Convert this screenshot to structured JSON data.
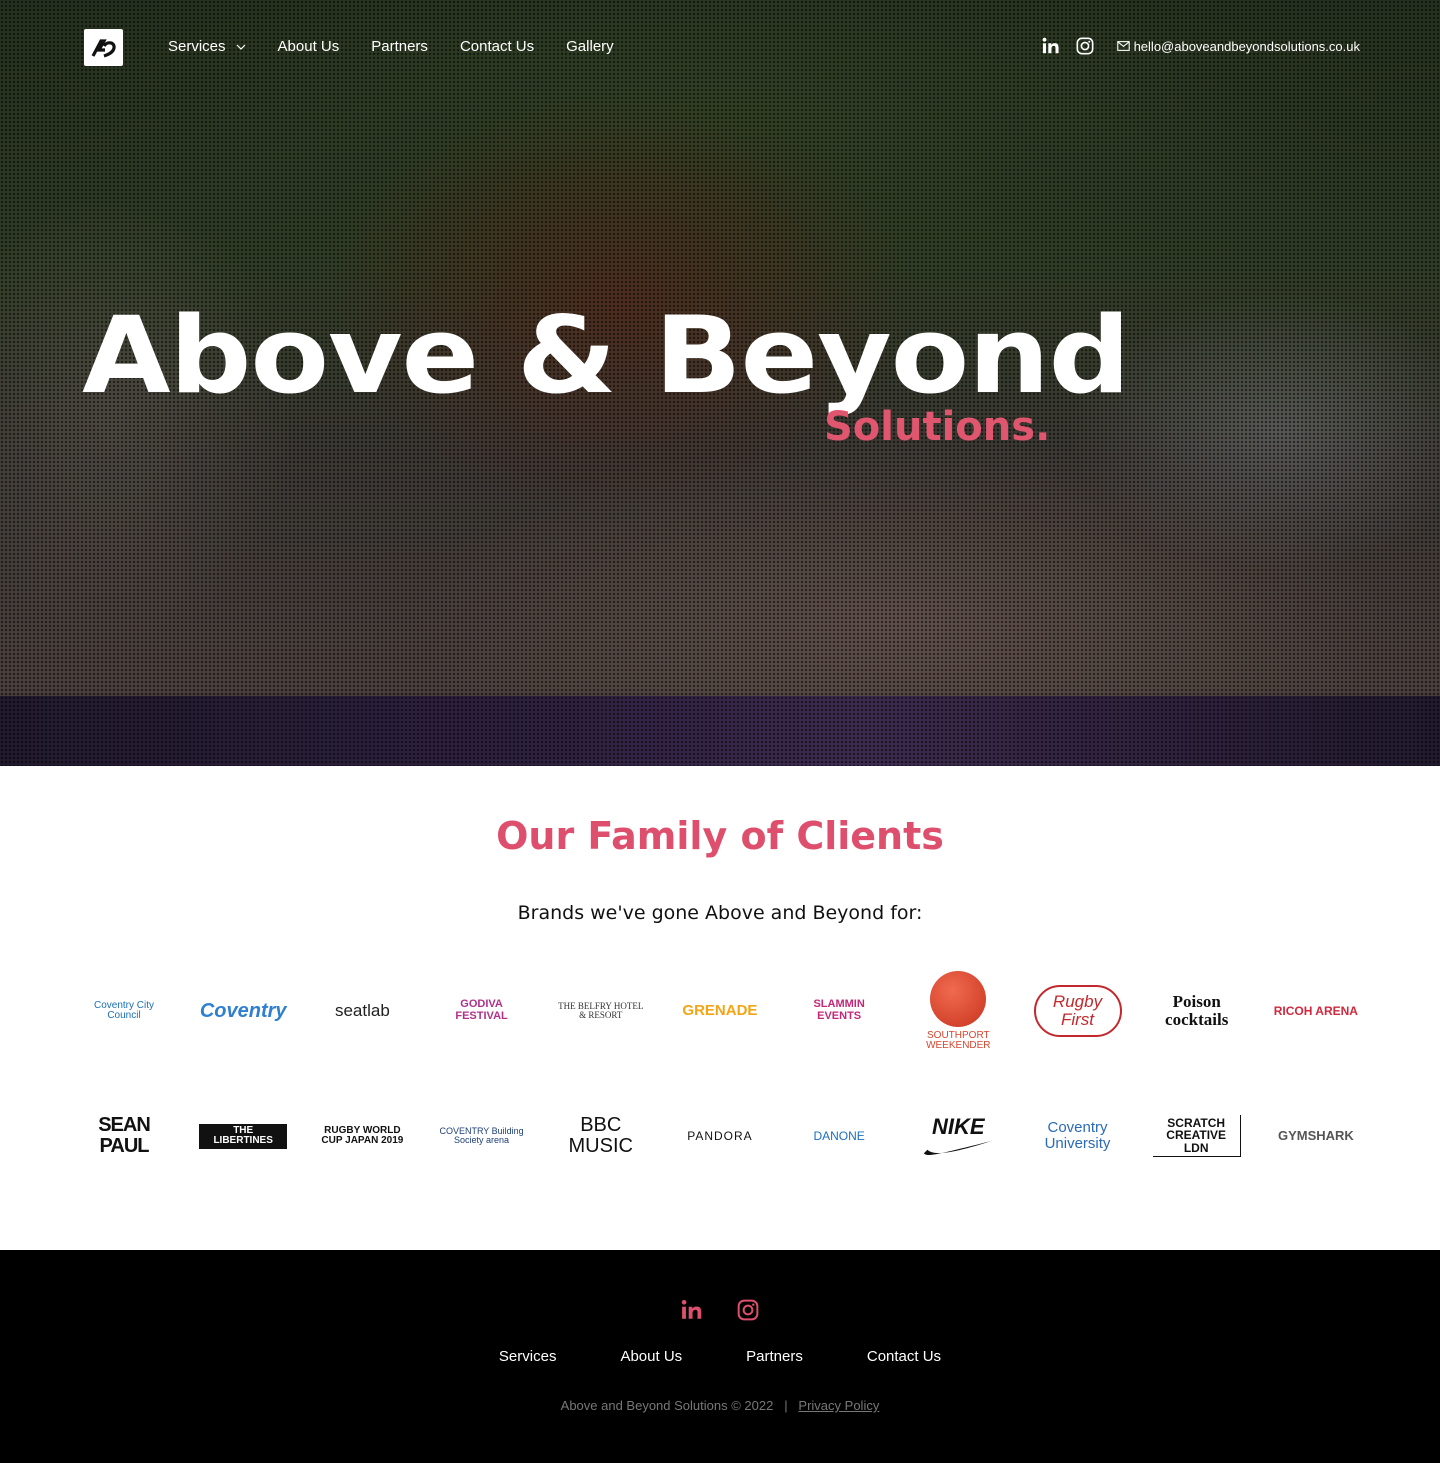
{
  "nav": {
    "items": [
      {
        "label": "Services",
        "has_dropdown": true
      },
      {
        "label": "About Us"
      },
      {
        "label": "Partners"
      },
      {
        "label": "Contact Us"
      },
      {
        "label": "Gallery"
      }
    ],
    "social_icons": [
      "linkedin-icon",
      "instagram-icon"
    ],
    "email": "hello@aboveandbeyondsolutions.co.uk"
  },
  "hero": {
    "title": "Above & Beyond",
    "subtitle": "Solutions."
  },
  "clients": {
    "title": "Our Family of Clients",
    "subtitle": "Brands we've gone Above and Beyond for:",
    "row1": [
      {
        "name": "Coventry City Council",
        "color": "#1a70b8"
      },
      {
        "name": "Coventry",
        "color": "#2f7fd0"
      },
      {
        "name": "seatlab",
        "color": "#222222"
      },
      {
        "name": "GODIVA FESTIVAL",
        "color": "#b0308a"
      },
      {
        "name": "THE BELFRY HOTEL & RESORT",
        "color": "#333333"
      },
      {
        "name": "GRENADE",
        "color": "#f3a515"
      },
      {
        "name": "SLAMMIN EVENTS",
        "color": "#c2287a"
      },
      {
        "name": "SOUTHPORT WEEKENDER",
        "color": "#d6452f"
      },
      {
        "name": "Rugby First",
        "color": "#c3282d"
      },
      {
        "name": "Poison cocktails",
        "color": "#111111"
      },
      {
        "name": "RICOH ARENA",
        "color": "#d1283e"
      }
    ],
    "row2": [
      {
        "name": "SEAN PAUL",
        "color": "#111111"
      },
      {
        "name": "THE LIBERTINES",
        "color": "#111111"
      },
      {
        "name": "RUGBY WORLD CUP JAPAN 2019",
        "color": "#111111"
      },
      {
        "name": "COVENTRY Building Society arena",
        "color": "#1d3f78"
      },
      {
        "name": "BBC MUSIC",
        "color": "#111111"
      },
      {
        "name": "PANDORA",
        "color": "#111111"
      },
      {
        "name": "DANONE",
        "color": "#1a6fc1"
      },
      {
        "name": "NIKE",
        "color": "#111111"
      },
      {
        "name": "Coventry University",
        "color": "#2a6ab8"
      },
      {
        "name": "SCRATCH CREATIVE LDN",
        "color": "#111111"
      },
      {
        "name": "GYMSHARK",
        "color": "#555555"
      }
    ]
  },
  "footer": {
    "social_icons": [
      "linkedin-icon",
      "instagram-icon"
    ],
    "links": [
      "Services",
      "About Us",
      "Partners",
      "Contact Us"
    ],
    "copyright": "Above and Beyond Solutions © 2022",
    "separator": "|",
    "privacy": "Privacy Policy"
  },
  "colors": {
    "accent": "#dd4f6c",
    "footer_bg": "#000000"
  }
}
